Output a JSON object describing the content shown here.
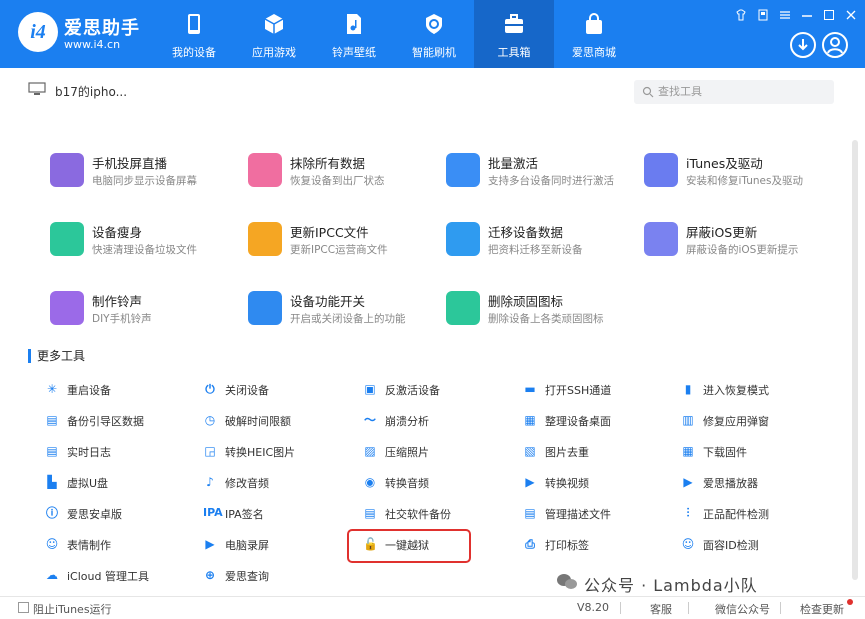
{
  "brand": {
    "name": "爱思助手",
    "url": "www.i4.cn",
    "logo_text": "i4"
  },
  "nav": [
    {
      "label": "我的设备",
      "icon": "phone-icon"
    },
    {
      "label": "应用游戏",
      "icon": "cube-icon"
    },
    {
      "label": "铃声壁纸",
      "icon": "music-file-icon"
    },
    {
      "label": "智能刷机",
      "icon": "flash-icon"
    },
    {
      "label": "工具箱",
      "icon": "toolbox-icon",
      "active": true
    },
    {
      "label": "爱思商城",
      "icon": "shopping-bag-icon"
    }
  ],
  "device": {
    "name": "b17的ipho..."
  },
  "search": {
    "placeholder": "查找工具"
  },
  "tools": [
    {
      "title": "手机投屏直播",
      "desc": "电脑同步显示设备屏幕",
      "color": "#8a6ae0"
    },
    {
      "title": "抹除所有数据",
      "desc": "恢复设备到出厂状态",
      "color": "#f06ea0"
    },
    {
      "title": "批量激活",
      "desc": "支持多台设备同时进行激活",
      "color": "#3a8ef5"
    },
    {
      "title": "iTunes及驱动",
      "desc": "安装和修复iTunes及驱动",
      "color": "#6a7cf0"
    },
    {
      "title": "设备瘦身",
      "desc": "快速清理设备垃圾文件",
      "color": "#2cc79a"
    },
    {
      "title": "更新IPCC文件",
      "desc": "更新IPCC运营商文件",
      "color": "#f5a623"
    },
    {
      "title": "迁移设备数据",
      "desc": "把资料迁移至新设备",
      "color": "#2f9bf0"
    },
    {
      "title": "屏蔽iOS更新",
      "desc": "屏蔽设备的iOS更新提示",
      "color": "#7a82f0"
    },
    {
      "title": "制作铃声",
      "desc": "DIY手机铃声",
      "color": "#9b6ae8"
    },
    {
      "title": "设备功能开关",
      "desc": "开启或关闭设备上的功能",
      "color": "#2f8af0"
    },
    {
      "title": "删除顽固图标",
      "desc": "删除设备上各类顽固图标",
      "color": "#2cc79a"
    }
  ],
  "more_title": "更多工具",
  "more_tools": [
    {
      "label": "重启设备",
      "icon": "spinner-icon",
      "glyph": "✳"
    },
    {
      "label": "关闭设备",
      "icon": "power-icon",
      "glyph": "⏻"
    },
    {
      "label": "反激活设备",
      "icon": "deactivate-icon",
      "glyph": "▣"
    },
    {
      "label": "打开SSH通道",
      "icon": "terminal-icon",
      "glyph": "▬"
    },
    {
      "label": "进入恢复模式",
      "icon": "recovery-icon",
      "glyph": "▮"
    },
    {
      "label": "备份引导区数据",
      "icon": "backup-icon",
      "glyph": "▤"
    },
    {
      "label": "破解时间限额",
      "icon": "clock-icon",
      "glyph": "◷"
    },
    {
      "label": "崩溃分析",
      "icon": "chart-icon",
      "glyph": "〜"
    },
    {
      "label": "整理设备桌面",
      "icon": "grid-icon",
      "glyph": "▦"
    },
    {
      "label": "修复应用弹窗",
      "icon": "repair-icon",
      "glyph": "▥"
    },
    {
      "label": "实时日志",
      "icon": "log-icon",
      "glyph": "▤"
    },
    {
      "label": "转换HEIC图片",
      "icon": "image-convert-icon",
      "glyph": "◲"
    },
    {
      "label": "压缩照片",
      "icon": "photo-icon",
      "glyph": "▨"
    },
    {
      "label": "图片去重",
      "icon": "image-dedupe-icon",
      "glyph": "▧"
    },
    {
      "label": "下载固件",
      "icon": "download-icon",
      "glyph": "▦"
    },
    {
      "label": "虚拟U盘",
      "icon": "usb-icon",
      "glyph": "▙"
    },
    {
      "label": "修改音频",
      "icon": "audio-edit-icon",
      "glyph": "♪"
    },
    {
      "label": "转换音频",
      "icon": "audio-convert-icon",
      "glyph": "◉"
    },
    {
      "label": "转换视频",
      "icon": "video-convert-icon",
      "glyph": "▶"
    },
    {
      "label": "爱思播放器",
      "icon": "player-icon",
      "glyph": "▶"
    },
    {
      "label": "爱思安卓版",
      "icon": "android-icon",
      "glyph": "ⓘ"
    },
    {
      "label": "IPA签名",
      "icon": "ipa-icon",
      "glyph": "IPA"
    },
    {
      "label": "社交软件备份",
      "icon": "social-backup-icon",
      "glyph": "▤"
    },
    {
      "label": "管理描述文件",
      "icon": "profile-icon",
      "glyph": "▤"
    },
    {
      "label": "正品配件检测",
      "icon": "accessory-icon",
      "glyph": "⫶"
    },
    {
      "label": "表情制作",
      "icon": "emoji-icon",
      "glyph": "☺"
    },
    {
      "label": "电脑录屏",
      "icon": "record-icon",
      "glyph": "▶"
    },
    {
      "label": "一键越狱",
      "icon": "unlock-icon",
      "glyph": "🔓"
    },
    {
      "label": "打印标签",
      "icon": "printer-icon",
      "glyph": "⎙"
    },
    {
      "label": "面容ID检测",
      "icon": "faceid-icon",
      "glyph": "☺"
    },
    {
      "label": "iCloud 管理工具",
      "icon": "cloud-icon",
      "glyph": "☁"
    },
    {
      "label": "爱思查询",
      "icon": "query-icon",
      "glyph": "⊕"
    }
  ],
  "footer": {
    "block_itunes": "阻止iTunes运行",
    "version": "V8.20",
    "service": "客服",
    "wechat": "微信公众号",
    "check_update": "检查更新"
  },
  "watermark": "公众号 · Lambda小队",
  "colors": {
    "primary": "#1b7ff0",
    "highlight": "#e0312e"
  }
}
